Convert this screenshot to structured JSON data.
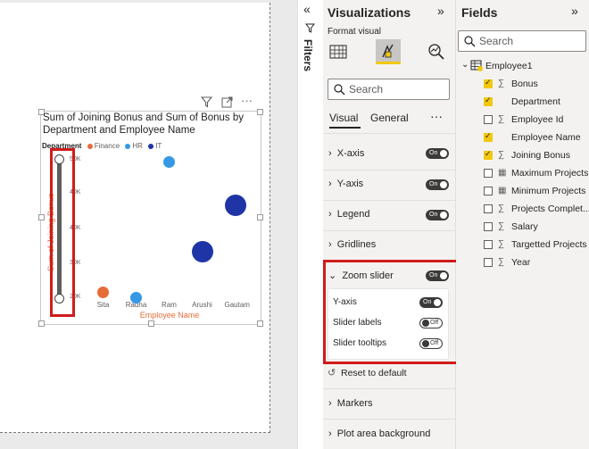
{
  "canvas": {
    "chart_title": "Sum of Joining Bonus and Sum of Bonus by Department and Employee Name",
    "legend_title": "Department",
    "legend_items": [
      {
        "label": "Finance",
        "color": "#e66c37"
      },
      {
        "label": "HR",
        "color": "#3599e6"
      },
      {
        "label": "IT",
        "color": "#1f35a6"
      }
    ],
    "y_axis_label": "Sum of Joining Bonus",
    "x_axis_label": "Employee Name",
    "more_label": "···"
  },
  "chart_data": {
    "type": "scatter",
    "categories": [
      "Sita",
      "Radha",
      "Ram",
      "Arushi",
      "Gautam"
    ],
    "y_ticks": [
      "50K",
      "40K",
      "40K",
      "30K",
      "20K"
    ],
    "points": [
      {
        "x": "Sita",
        "y": 21000,
        "department": "Finance",
        "size": "small"
      },
      {
        "x": "Radha",
        "y": 20000,
        "department": "HR",
        "size": "small"
      },
      {
        "x": "Ram",
        "y": 50000,
        "department": "HR",
        "size": "small"
      },
      {
        "x": "Arushi",
        "y": 30000,
        "department": "IT",
        "size": "large"
      },
      {
        "x": "Gautam",
        "y": 40000,
        "department": "IT",
        "size": "large"
      }
    ],
    "xlabel": "Employee Name",
    "ylabel": "Sum of Joining Bonus"
  },
  "filters": {
    "label": "Filters"
  },
  "viz_pane": {
    "title": "Visualizations",
    "format_visual": "Format visual",
    "search_placeholder": "Search",
    "tabs": [
      "Visual",
      "General"
    ],
    "more": "···",
    "sections": [
      {
        "label": "X-axis",
        "toggle": "On"
      },
      {
        "label": "Y-axis",
        "toggle": "On"
      },
      {
        "label": "Legend",
        "toggle": "On"
      },
      {
        "label": "Gridlines",
        "toggle": ""
      },
      {
        "label": "Zoom slider",
        "toggle": "On"
      }
    ],
    "zoom_options": [
      {
        "label": "Y-axis",
        "toggle": "On"
      },
      {
        "label": "Slider labels",
        "toggle": "Off"
      },
      {
        "label": "Slider tooltips",
        "toggle": "Off"
      }
    ],
    "reset": "Reset to default",
    "after_sections": [
      "Markers",
      "Plot area background"
    ]
  },
  "fields_pane": {
    "title": "Fields",
    "search_placeholder": "Search",
    "table_name": "Employee1",
    "fields": [
      {
        "name": "Bonus",
        "checked": true,
        "icon": "sigma-icon"
      },
      {
        "name": "Department",
        "checked": true,
        "icon": ""
      },
      {
        "name": "Employee Id",
        "checked": false,
        "icon": "sigma-icon"
      },
      {
        "name": "Employee Name",
        "checked": true,
        "icon": ""
      },
      {
        "name": "Joining Bonus",
        "checked": true,
        "icon": "sigma-icon"
      },
      {
        "name": "Maximum Projects",
        "checked": false,
        "icon": "calculator-icon"
      },
      {
        "name": "Minimum Projects",
        "checked": false,
        "icon": "calculator-icon"
      },
      {
        "name": "Projects Complet...",
        "checked": false,
        "icon": "sigma-icon"
      },
      {
        "name": "Salary",
        "checked": false,
        "icon": "sigma-icon"
      },
      {
        "name": "Targetted Projects",
        "checked": false,
        "icon": "sigma-icon"
      },
      {
        "name": "Year",
        "checked": false,
        "icon": "sigma-icon"
      }
    ]
  }
}
